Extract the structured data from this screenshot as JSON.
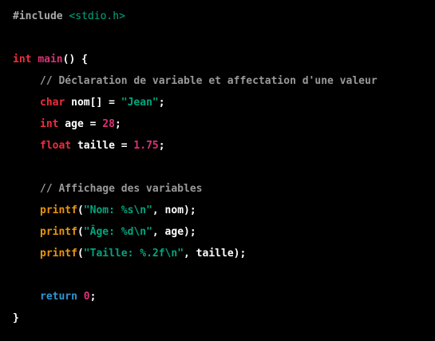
{
  "code": {
    "include_directive": "#include",
    "include_header": " <stdio.h>",
    "main_type": "int",
    "main_name": "main",
    "main_open": "() {",
    "comment_decl": "// Déclaration de variable et affectation d'une valeur",
    "char_kw": "char",
    "char_decl": " nom[] = ",
    "char_val": "\"Jean\"",
    "semicolon": ";",
    "int_kw": "int",
    "int_decl": " age = ",
    "int_val": "28",
    "float_kw": "float",
    "float_decl": " taille = ",
    "float_val": "1.75",
    "comment_print": "// Affichage des variables",
    "printf": "printf",
    "paren_open": "(",
    "printf1_str": "\"Nom: %s\\n\"",
    "printf1_args": ", nom);",
    "printf2_str": "\"Âge: %d\\n\"",
    "printf2_args": ", age);",
    "printf3_str": "\"Taille: %.2f\\n\"",
    "printf3_args": ", taille);",
    "return_kw": "return",
    "return_val": " 0",
    "close_brace": "}"
  }
}
